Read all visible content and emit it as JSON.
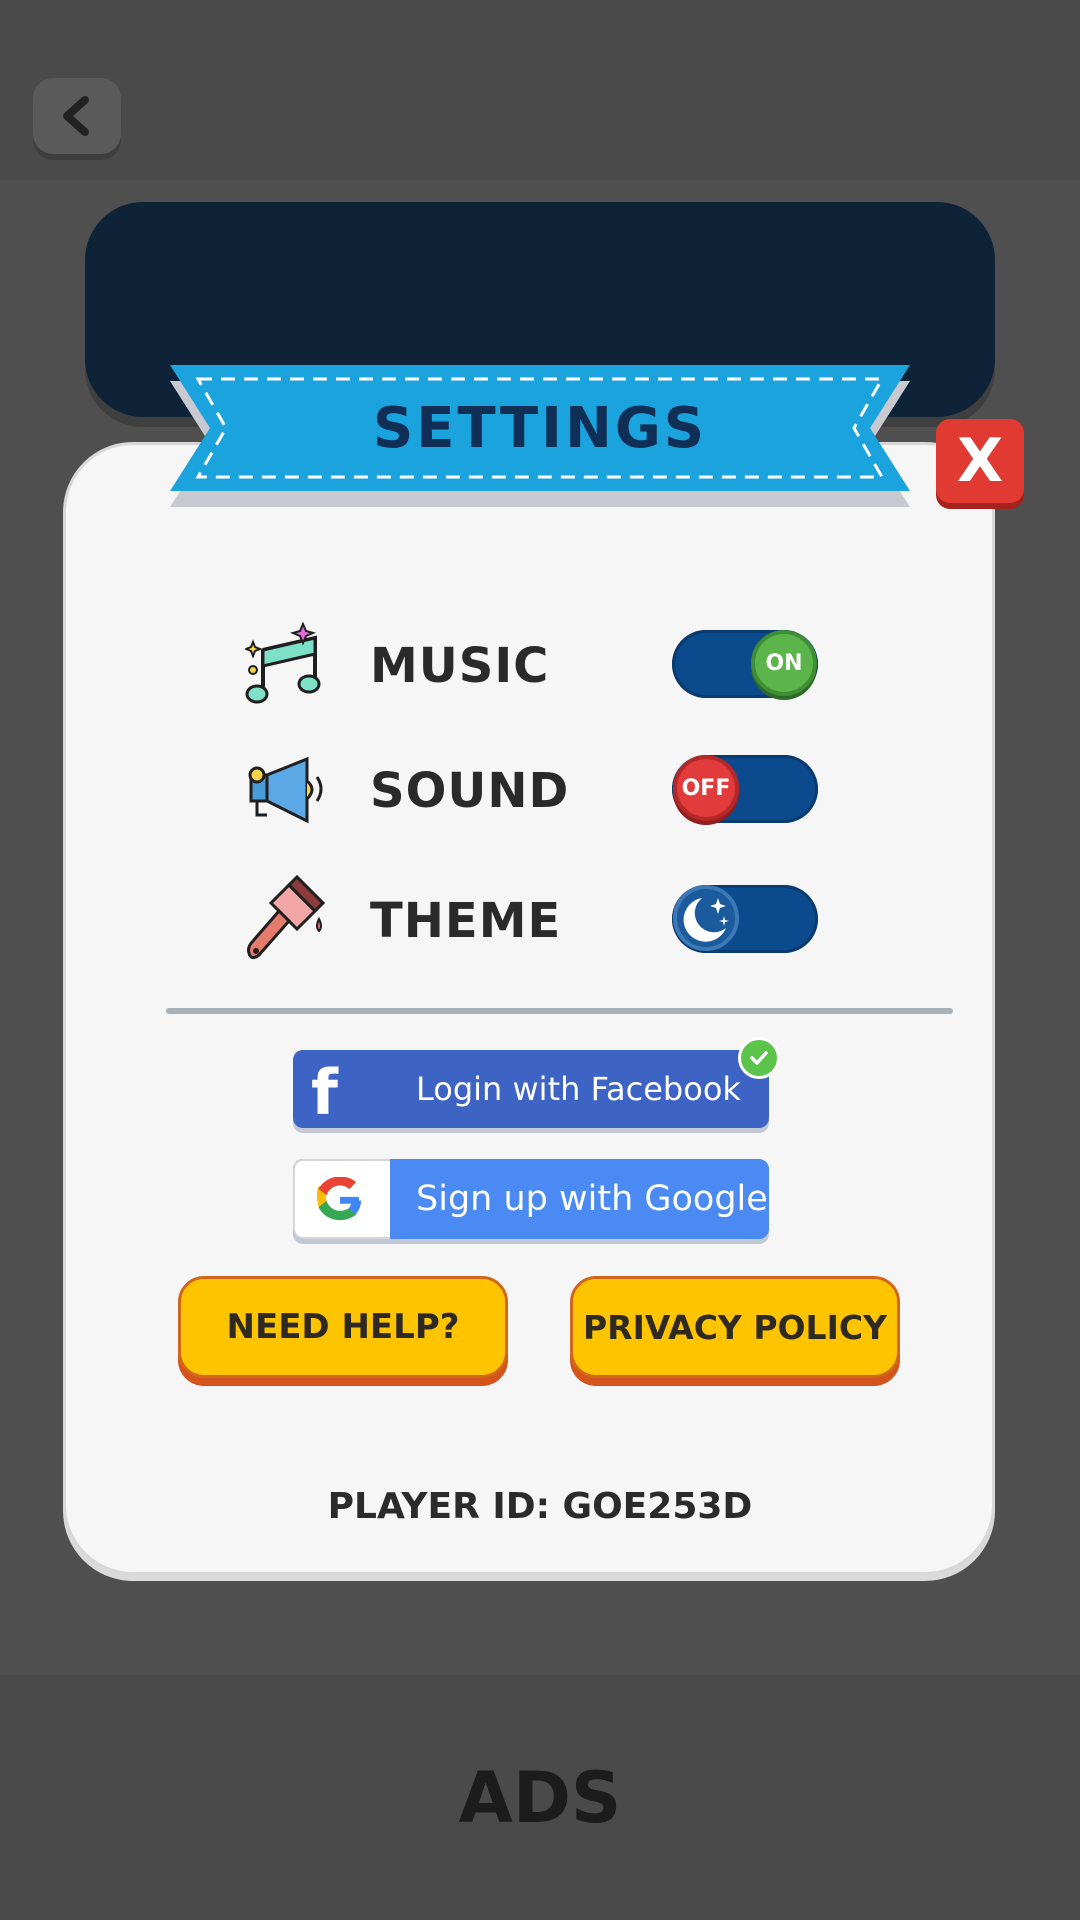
{
  "header": {
    "back_icon": "chevron-left-icon"
  },
  "dialog": {
    "title": "SETTINGS",
    "close_label": "X"
  },
  "settings": [
    {
      "key": "music",
      "label": "MUSIC",
      "icon": "music-notes-icon",
      "state": "on",
      "state_label": "ON"
    },
    {
      "key": "sound",
      "label": "SOUND",
      "icon": "megaphone-icon",
      "state": "off",
      "state_label": "OFF"
    },
    {
      "key": "theme",
      "label": "THEME",
      "icon": "paint-brush-icon",
      "state": "dark",
      "state_icon": "moon-stars-icon"
    }
  ],
  "social": {
    "facebook_label": "Login with Facebook",
    "facebook_icon": "facebook-f-icon",
    "facebook_connected": true,
    "google_label": "Sign up with Google",
    "google_icon": "google-g-icon"
  },
  "buttons": {
    "help_label": "NEED HELP?",
    "privacy_label": "PRIVACY POLICY"
  },
  "player_id": "PLAYER ID: GOE253D",
  "ads_label": "ADS",
  "colors": {
    "background": "#4f4f4f",
    "panel_dark": "#0e2238",
    "ribbon": "#1ba3de",
    "toggle_track": "#0b4a8c",
    "on": "#5bb54a",
    "off": "#e23b3b",
    "facebook": "#3d64c4",
    "google": "#4a8af2",
    "yellow": "#ffc400"
  }
}
